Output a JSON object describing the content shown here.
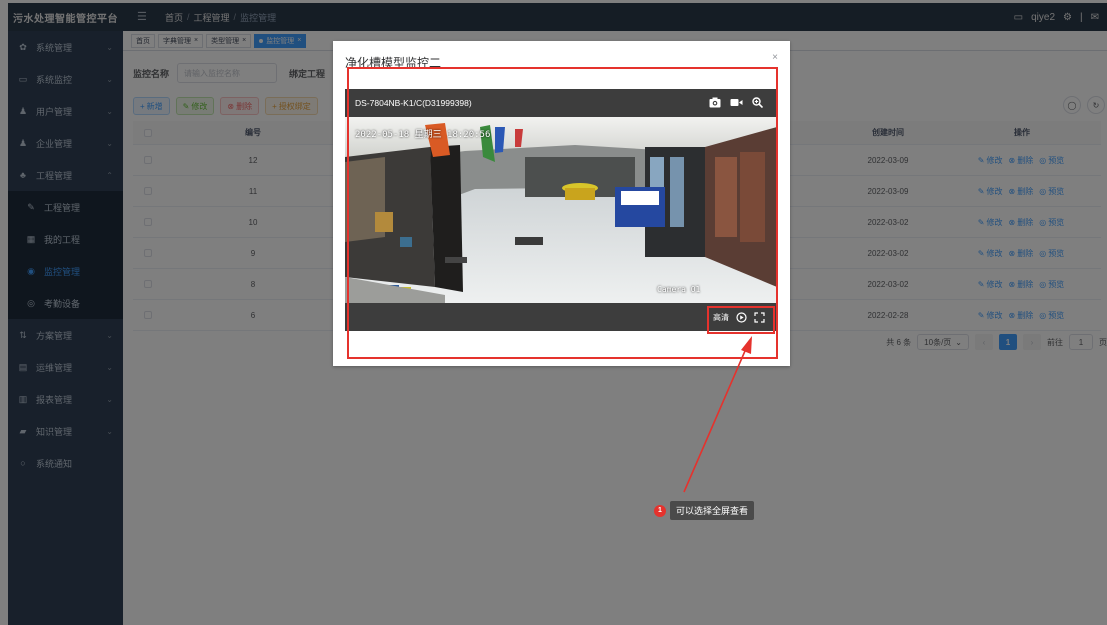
{
  "app": {
    "title": "污水处理智能管控平台"
  },
  "sidebar": {
    "items": [
      {
        "label": "系统管理",
        "icon": "gear-icon"
      },
      {
        "label": "系统监控",
        "icon": "monitor-icon"
      },
      {
        "label": "用户管理",
        "icon": "user-icon"
      },
      {
        "label": "企业管理",
        "icon": "user-icon"
      },
      {
        "label": "工程管理",
        "icon": "users-icon"
      },
      {
        "label": "方案管理",
        "icon": "doc-icon"
      },
      {
        "label": "运维管理",
        "icon": "chart-icon"
      },
      {
        "label": "报表管理",
        "icon": "table-icon"
      },
      {
        "label": "知识管理",
        "icon": "book-icon"
      },
      {
        "label": "系统通知",
        "icon": "bell-icon"
      }
    ],
    "submenu": [
      {
        "label": "工程管理",
        "icon": "edit-icon"
      },
      {
        "label": "我的工程",
        "icon": "grid-icon"
      },
      {
        "label": "监控管理",
        "icon": "eye-icon",
        "active": true
      },
      {
        "label": "考勤设备",
        "icon": "device-icon"
      }
    ]
  },
  "header": {
    "breadcrumb": [
      "首页",
      "工程管理",
      "监控管理"
    ],
    "user": "qiye2"
  },
  "tags": [
    {
      "label": "首页"
    },
    {
      "label": "字典管理"
    },
    {
      "label": "类型管理"
    },
    {
      "label": "监控管理",
      "active": true
    }
  ],
  "search": {
    "label": "监控名称",
    "placeholder": "请输入监控名称",
    "label2": "绑定工程"
  },
  "toolbar": {
    "add": "新增",
    "edit": "修改",
    "delete": "删除",
    "bind": "授权绑定"
  },
  "table": {
    "headers": {
      "id": "编号",
      "created": "创建时间",
      "ops": "操作"
    },
    "ops": {
      "edit": "修改",
      "delete": "删除",
      "preview": "预览"
    },
    "rows": [
      {
        "id": "12",
        "created": "2022-03-09"
      },
      {
        "id": "11",
        "created": "2022-03-09"
      },
      {
        "id": "10",
        "created": "2022-03-02"
      },
      {
        "id": "9",
        "created": "2022-03-02"
      },
      {
        "id": "8",
        "created": "2022-03-02"
      },
      {
        "id": "6",
        "created": "2022-02-28"
      }
    ]
  },
  "pagination": {
    "total": "共 6 条",
    "page_size": "10条/页",
    "current": "1",
    "goto_label": "前往",
    "goto_value": "1",
    "page_unit": "页"
  },
  "dialog": {
    "title": "净化槽模型监控二",
    "close": "×",
    "device_name": "DS-7804NB-K1/C(D31999398)",
    "osd_time": "2022-05-18 星期三 18:20:56",
    "camera_label": "Camera 01",
    "quality_label": "高清"
  },
  "annotation": {
    "number": "1",
    "text": "可以选择全屏查看",
    "color": "#e5322d"
  }
}
